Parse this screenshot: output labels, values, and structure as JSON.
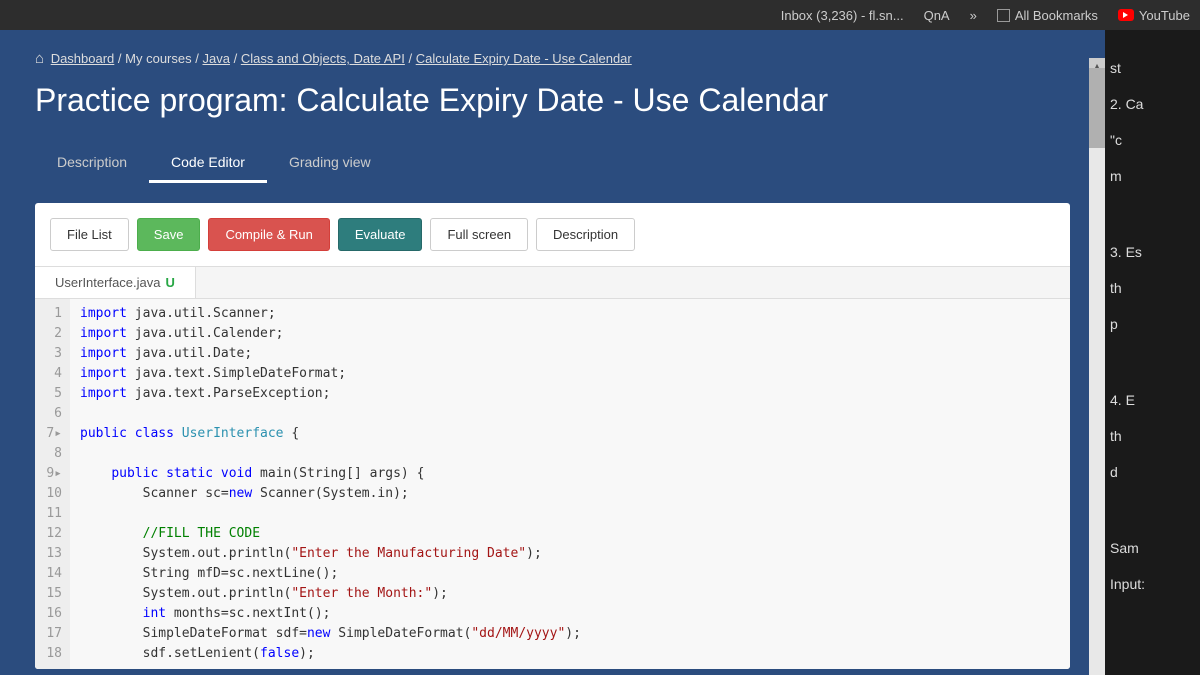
{
  "browser": {
    "tabs": [
      {
        "label": "Inbox (3,236) - fl.sn..."
      },
      {
        "label": "QnA"
      }
    ],
    "more": "»",
    "bookmarks_label": "All Bookmarks",
    "youtube_label": "YouTube"
  },
  "breadcrumb": {
    "items": [
      "Dashboard",
      "My courses",
      "Java",
      "Class and Objects, Date API",
      "Calculate Expiry Date - Use Calendar"
    ],
    "separator": " / "
  },
  "page_title": "Practice program: Calculate Expiry Date - Use Calendar",
  "tabs": {
    "items": [
      "Description",
      "Code Editor",
      "Grading view"
    ],
    "active": 1
  },
  "toolbar": {
    "file_list": "File List",
    "save": "Save",
    "compile_run": "Compile & Run",
    "evaluate": "Evaluate",
    "full_screen": "Full screen",
    "description": "Description"
  },
  "file_tab": {
    "name": "UserInterface.java",
    "modified": "U"
  },
  "code": {
    "lines": [
      {
        "n": "1",
        "html": "<span class='kw'>import</span> java.util.Scanner;"
      },
      {
        "n": "2",
        "html": "<span class='kw'>import</span> java.util.Calender;"
      },
      {
        "n": "3",
        "html": "<span class='kw'>import</span> java.util.Date;"
      },
      {
        "n": "4",
        "html": "<span class='kw'>import</span> java.text.SimpleDateFormat;"
      },
      {
        "n": "5",
        "html": "<span class='kw'>import</span> java.text.ParseException;"
      },
      {
        "n": "6",
        "html": ""
      },
      {
        "n": "7▸",
        "html": "<span class='kw'>public</span> <span class='kw'>class</span> <span class='typ'>UserInterface</span> {"
      },
      {
        "n": "8",
        "html": ""
      },
      {
        "n": "9▸",
        "html": "    <span class='kw'>public</span> <span class='kw'>static</span> <span class='kw'>void</span> main(String[] args) {"
      },
      {
        "n": "10",
        "html": "        Scanner sc=<span class='kw'>new</span> Scanner(System.in);"
      },
      {
        "n": "11",
        "html": ""
      },
      {
        "n": "12",
        "html": "        <span class='cm'>//FILL THE CODE</span>"
      },
      {
        "n": "13",
        "html": "        System.out.println(<span class='str'>\"Enter the Manufacturing Date\"</span>);"
      },
      {
        "n": "14",
        "html": "        String mfD=sc.nextLine();"
      },
      {
        "n": "15",
        "html": "        System.out.println(<span class='str'>\"Enter the Month:\"</span>);"
      },
      {
        "n": "16",
        "html": "        <span class='kw'>int</span> months=sc.nextInt();"
      },
      {
        "n": "17",
        "html": "        SimpleDateFormat sdf=<span class='kw'>new</span> SimpleDateFormat(<span class='str'>\"dd/MM/yyyy\"</span>);"
      },
      {
        "n": "18",
        "html": "        sdf.setLenient(<span class='bool'>false</span>);"
      }
    ]
  },
  "right_panel": {
    "items": [
      "st",
      "2. Ca",
      "\"c",
      "m",
      "3. Es",
      "th",
      "p",
      "4. E",
      "th",
      "d",
      "Sam",
      "Input:"
    ]
  }
}
